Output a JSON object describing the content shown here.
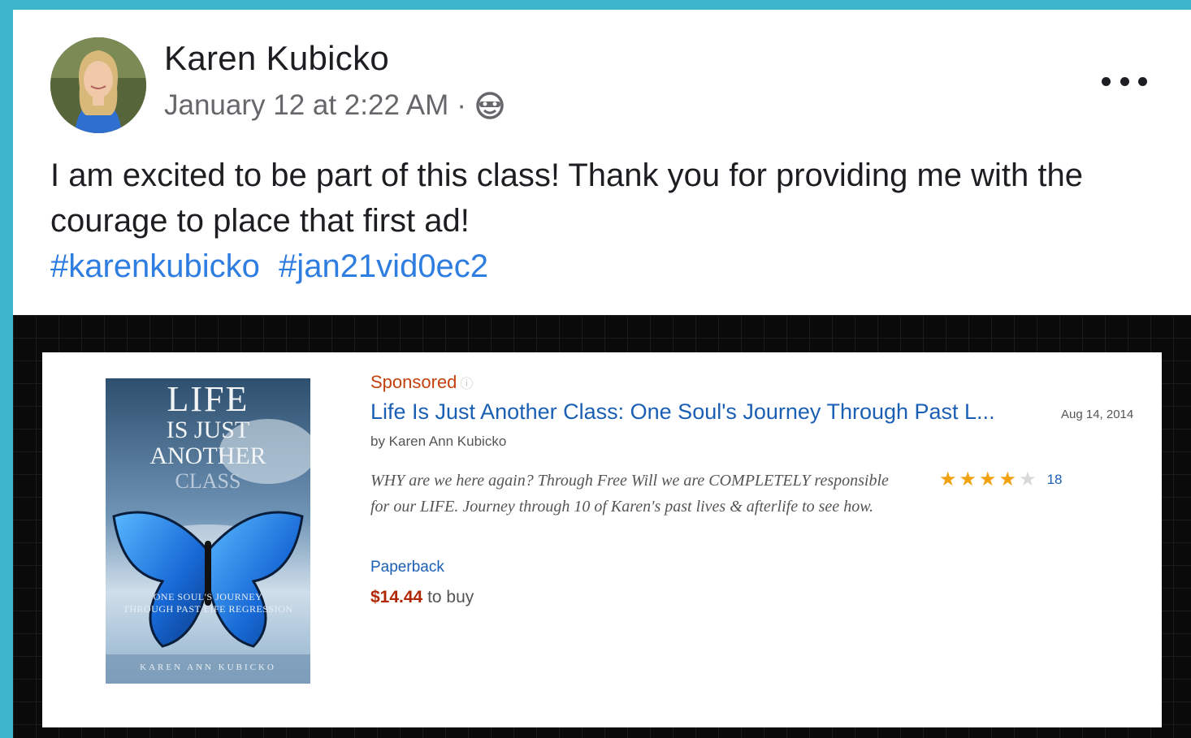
{
  "post": {
    "author": "Karen Kubicko",
    "timestamp": "January 12 at 2:22 AM",
    "separator": "·",
    "privacy_icon": "globe-icon",
    "more_icon": "more-options-icon",
    "text": "I am excited to be part of this class! Thank you for providing me with the courage to place that first ad!",
    "hashtags": [
      "#karenkubicko",
      "#jan21vid0ec2"
    ]
  },
  "ad": {
    "sponsored_label": "Sponsored",
    "info_icon": "ⓘ",
    "title": "Life Is Just Another Class: One Soul's Journey Through Past L...",
    "date": "Aug 14, 2014",
    "byline": "by Karen Ann Kubicko",
    "description": "WHY are we here again? Through Free Will we are COMPLETELY responsible for our LIFE. Journey through 10 of Karen's past lives & afterlife to see how.",
    "rating": 4,
    "rating_max": 5,
    "review_count": "18",
    "format": "Paperback",
    "price": "$14.44",
    "price_suffix": "to buy",
    "book_cover": {
      "title_lines": [
        "LIFE",
        "IS JUST",
        "ANOTHER",
        "CLASS"
      ],
      "subtitle_lines": [
        "ONE SOUL'S JOURNEY",
        "THROUGH PAST LIFE REGRESSION"
      ],
      "author": "KAREN ANN KUBICKO"
    }
  },
  "colors": {
    "frame": "#3db6cc",
    "hashtag": "#2e7de1",
    "link": "#1a5fb4",
    "sponsored": "#c2410c",
    "price": "#b12704",
    "star": "#f0a20f"
  }
}
